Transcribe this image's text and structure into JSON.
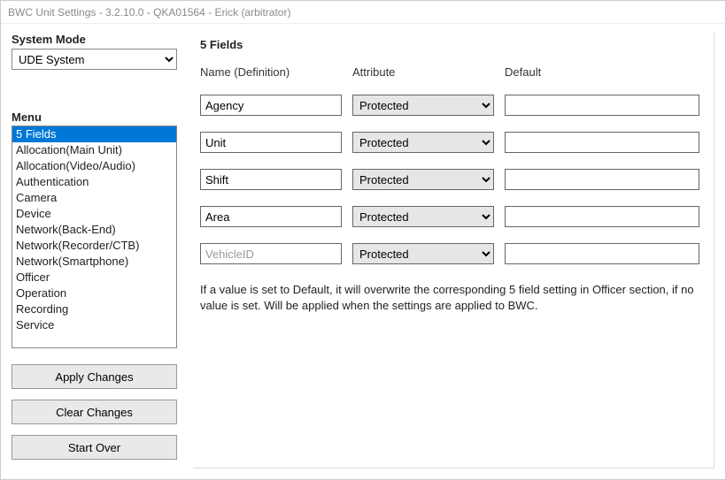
{
  "window": {
    "title": "BWC Unit Settings - 3.2.10.0 - QKA01564 - Erick (arbitrator)"
  },
  "system_mode": {
    "label": "System Mode",
    "selected": "UDE System"
  },
  "menu": {
    "label": "Menu",
    "items": [
      "5 Fields",
      "Allocation(Main Unit)",
      "Allocation(Video/Audio)",
      "Authentication",
      "Camera",
      "Device",
      "Network(Back-End)",
      "Network(Recorder/CTB)",
      "Network(Smartphone)",
      "Officer",
      "Operation",
      "Recording",
      "Service"
    ],
    "selected_index": 0
  },
  "buttons": {
    "apply": "Apply Changes",
    "clear": "Clear Changes",
    "start_over": "Start Over"
  },
  "panel": {
    "title": "5 Fields",
    "columns": {
      "name": "Name (Definition)",
      "attribute": "Attribute",
      "default": "Default"
    },
    "rows": [
      {
        "name": "Agency",
        "attribute": "Protected",
        "default": "",
        "readonly": false
      },
      {
        "name": "Unit",
        "attribute": "Protected",
        "default": "",
        "readonly": false
      },
      {
        "name": "Shift",
        "attribute": "Protected",
        "default": "",
        "readonly": false
      },
      {
        "name": "Area",
        "attribute": "Protected",
        "default": "",
        "readonly": false
      },
      {
        "name": "VehicleID",
        "attribute": "Protected",
        "default": "",
        "readonly": true
      }
    ],
    "note": "If a value is set to Default, it will overwrite the corresponding 5 field setting in Officer section, if no value is set. Will be applied when the settings are applied to BWC."
  }
}
